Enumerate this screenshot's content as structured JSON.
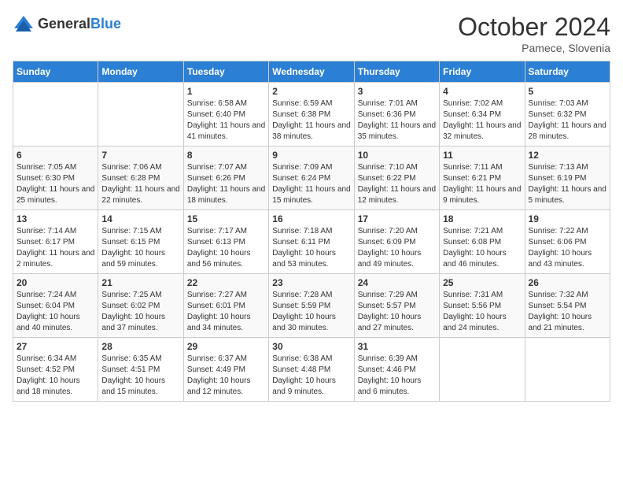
{
  "header": {
    "logo_general": "General",
    "logo_blue": "Blue",
    "month_title": "October 2024",
    "location": "Pamece, Slovenia"
  },
  "days_of_week": [
    "Sunday",
    "Monday",
    "Tuesday",
    "Wednesday",
    "Thursday",
    "Friday",
    "Saturday"
  ],
  "weeks": [
    [
      {
        "day": "",
        "sunrise": "",
        "sunset": "",
        "daylight": ""
      },
      {
        "day": "",
        "sunrise": "",
        "sunset": "",
        "daylight": ""
      },
      {
        "day": "1",
        "sunrise": "Sunrise: 6:58 AM",
        "sunset": "Sunset: 6:40 PM",
        "daylight": "Daylight: 11 hours and 41 minutes."
      },
      {
        "day": "2",
        "sunrise": "Sunrise: 6:59 AM",
        "sunset": "Sunset: 6:38 PM",
        "daylight": "Daylight: 11 hours and 38 minutes."
      },
      {
        "day": "3",
        "sunrise": "Sunrise: 7:01 AM",
        "sunset": "Sunset: 6:36 PM",
        "daylight": "Daylight: 11 hours and 35 minutes."
      },
      {
        "day": "4",
        "sunrise": "Sunrise: 7:02 AM",
        "sunset": "Sunset: 6:34 PM",
        "daylight": "Daylight: 11 hours and 32 minutes."
      },
      {
        "day": "5",
        "sunrise": "Sunrise: 7:03 AM",
        "sunset": "Sunset: 6:32 PM",
        "daylight": "Daylight: 11 hours and 28 minutes."
      }
    ],
    [
      {
        "day": "6",
        "sunrise": "Sunrise: 7:05 AM",
        "sunset": "Sunset: 6:30 PM",
        "daylight": "Daylight: 11 hours and 25 minutes."
      },
      {
        "day": "7",
        "sunrise": "Sunrise: 7:06 AM",
        "sunset": "Sunset: 6:28 PM",
        "daylight": "Daylight: 11 hours and 22 minutes."
      },
      {
        "day": "8",
        "sunrise": "Sunrise: 7:07 AM",
        "sunset": "Sunset: 6:26 PM",
        "daylight": "Daylight: 11 hours and 18 minutes."
      },
      {
        "day": "9",
        "sunrise": "Sunrise: 7:09 AM",
        "sunset": "Sunset: 6:24 PM",
        "daylight": "Daylight: 11 hours and 15 minutes."
      },
      {
        "day": "10",
        "sunrise": "Sunrise: 7:10 AM",
        "sunset": "Sunset: 6:22 PM",
        "daylight": "Daylight: 11 hours and 12 minutes."
      },
      {
        "day": "11",
        "sunrise": "Sunrise: 7:11 AM",
        "sunset": "Sunset: 6:21 PM",
        "daylight": "Daylight: 11 hours and 9 minutes."
      },
      {
        "day": "12",
        "sunrise": "Sunrise: 7:13 AM",
        "sunset": "Sunset: 6:19 PM",
        "daylight": "Daylight: 11 hours and 5 minutes."
      }
    ],
    [
      {
        "day": "13",
        "sunrise": "Sunrise: 7:14 AM",
        "sunset": "Sunset: 6:17 PM",
        "daylight": "Daylight: 11 hours and 2 minutes."
      },
      {
        "day": "14",
        "sunrise": "Sunrise: 7:15 AM",
        "sunset": "Sunset: 6:15 PM",
        "daylight": "Daylight: 10 hours and 59 minutes."
      },
      {
        "day": "15",
        "sunrise": "Sunrise: 7:17 AM",
        "sunset": "Sunset: 6:13 PM",
        "daylight": "Daylight: 10 hours and 56 minutes."
      },
      {
        "day": "16",
        "sunrise": "Sunrise: 7:18 AM",
        "sunset": "Sunset: 6:11 PM",
        "daylight": "Daylight: 10 hours and 53 minutes."
      },
      {
        "day": "17",
        "sunrise": "Sunrise: 7:20 AM",
        "sunset": "Sunset: 6:09 PM",
        "daylight": "Daylight: 10 hours and 49 minutes."
      },
      {
        "day": "18",
        "sunrise": "Sunrise: 7:21 AM",
        "sunset": "Sunset: 6:08 PM",
        "daylight": "Daylight: 10 hours and 46 minutes."
      },
      {
        "day": "19",
        "sunrise": "Sunrise: 7:22 AM",
        "sunset": "Sunset: 6:06 PM",
        "daylight": "Daylight: 10 hours and 43 minutes."
      }
    ],
    [
      {
        "day": "20",
        "sunrise": "Sunrise: 7:24 AM",
        "sunset": "Sunset: 6:04 PM",
        "daylight": "Daylight: 10 hours and 40 minutes."
      },
      {
        "day": "21",
        "sunrise": "Sunrise: 7:25 AM",
        "sunset": "Sunset: 6:02 PM",
        "daylight": "Daylight: 10 hours and 37 minutes."
      },
      {
        "day": "22",
        "sunrise": "Sunrise: 7:27 AM",
        "sunset": "Sunset: 6:01 PM",
        "daylight": "Daylight: 10 hours and 34 minutes."
      },
      {
        "day": "23",
        "sunrise": "Sunrise: 7:28 AM",
        "sunset": "Sunset: 5:59 PM",
        "daylight": "Daylight: 10 hours and 30 minutes."
      },
      {
        "day": "24",
        "sunrise": "Sunrise: 7:29 AM",
        "sunset": "Sunset: 5:57 PM",
        "daylight": "Daylight: 10 hours and 27 minutes."
      },
      {
        "day": "25",
        "sunrise": "Sunrise: 7:31 AM",
        "sunset": "Sunset: 5:56 PM",
        "daylight": "Daylight: 10 hours and 24 minutes."
      },
      {
        "day": "26",
        "sunrise": "Sunrise: 7:32 AM",
        "sunset": "Sunset: 5:54 PM",
        "daylight": "Daylight: 10 hours and 21 minutes."
      }
    ],
    [
      {
        "day": "27",
        "sunrise": "Sunrise: 6:34 AM",
        "sunset": "Sunset: 4:52 PM",
        "daylight": "Daylight: 10 hours and 18 minutes."
      },
      {
        "day": "28",
        "sunrise": "Sunrise: 6:35 AM",
        "sunset": "Sunset: 4:51 PM",
        "daylight": "Daylight: 10 hours and 15 minutes."
      },
      {
        "day": "29",
        "sunrise": "Sunrise: 6:37 AM",
        "sunset": "Sunset: 4:49 PM",
        "daylight": "Daylight: 10 hours and 12 minutes."
      },
      {
        "day": "30",
        "sunrise": "Sunrise: 6:38 AM",
        "sunset": "Sunset: 4:48 PM",
        "daylight": "Daylight: 10 hours and 9 minutes."
      },
      {
        "day": "31",
        "sunrise": "Sunrise: 6:39 AM",
        "sunset": "Sunset: 4:46 PM",
        "daylight": "Daylight: 10 hours and 6 minutes."
      },
      {
        "day": "",
        "sunrise": "",
        "sunset": "",
        "daylight": ""
      },
      {
        "day": "",
        "sunrise": "",
        "sunset": "",
        "daylight": ""
      }
    ]
  ]
}
